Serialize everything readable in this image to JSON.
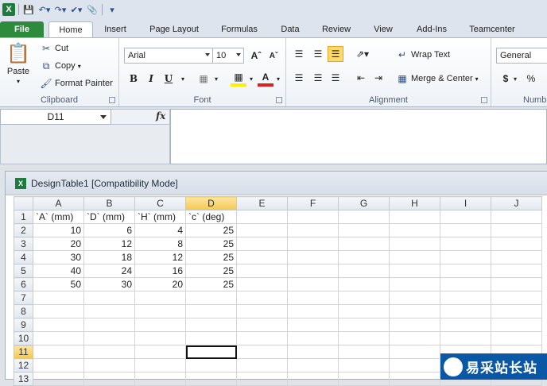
{
  "quick_access": {
    "logo": "X"
  },
  "tabs": [
    {
      "label": "File"
    },
    {
      "label": "Home"
    },
    {
      "label": "Insert"
    },
    {
      "label": "Page Layout"
    },
    {
      "label": "Formulas"
    },
    {
      "label": "Data"
    },
    {
      "label": "Review"
    },
    {
      "label": "View"
    },
    {
      "label": "Add-Ins"
    },
    {
      "label": "Teamcenter"
    }
  ],
  "ribbon": {
    "clipboard": {
      "label": "Clipboard",
      "paste": "Paste",
      "cut": "Cut",
      "copy": "Copy",
      "format_painter": "Format Painter"
    },
    "font": {
      "label": "Font",
      "font_name": "Arial",
      "font_size": "10",
      "bold": "B",
      "italic": "I",
      "underline": "U"
    },
    "alignment": {
      "label": "Alignment",
      "wrap_text": "Wrap Text",
      "merge_center": "Merge & Center"
    },
    "number": {
      "label": "Numb",
      "format": "General",
      "currency": "$",
      "percent": "%"
    }
  },
  "formula_bar": {
    "name_box": "D11",
    "fx": "fx",
    "formula": ""
  },
  "workbook": {
    "title": "DesignTable1  [Compatibility Mode]",
    "icon": "X"
  },
  "sheet": {
    "columns": [
      "A",
      "B",
      "C",
      "D",
      "E",
      "F",
      "G",
      "H",
      "I",
      "J"
    ],
    "rows": [
      [
        "`A` (mm)",
        "`D` (mm)",
        "`H` (mm)",
        "`c` (deg)",
        "",
        "",
        "",
        "",
        "",
        ""
      ],
      [
        "10",
        "6",
        "4",
        "25",
        "",
        "",
        "",
        "",
        "",
        ""
      ],
      [
        "20",
        "12",
        "8",
        "25",
        "",
        "",
        "",
        "",
        "",
        ""
      ],
      [
        "30",
        "18",
        "12",
        "25",
        "",
        "",
        "",
        "",
        "",
        ""
      ],
      [
        "40",
        "24",
        "16",
        "25",
        "",
        "",
        "",
        "",
        "",
        ""
      ],
      [
        "50",
        "30",
        "20",
        "25",
        "",
        "",
        "",
        "",
        "",
        ""
      ],
      [
        "",
        "",
        "",
        "",
        "",
        "",
        "",
        "",
        "",
        ""
      ],
      [
        "",
        "",
        "",
        "",
        "",
        "",
        "",
        "",
        "",
        ""
      ],
      [
        "",
        "",
        "",
        "",
        "",
        "",
        "",
        "",
        "",
        ""
      ],
      [
        "",
        "",
        "",
        "",
        "",
        "",
        "",
        "",
        "",
        ""
      ],
      [
        "",
        "",
        "",
        "",
        "",
        "",
        "",
        "",
        "",
        ""
      ],
      [
        "",
        "",
        "",
        "",
        "",
        "",
        "",
        "",
        "",
        ""
      ],
      [
        "",
        "",
        "",
        "",
        "",
        "",
        "",
        "",
        "",
        ""
      ]
    ],
    "active_cell": "D11"
  },
  "watermark": {
    "text": "易采站长站"
  }
}
